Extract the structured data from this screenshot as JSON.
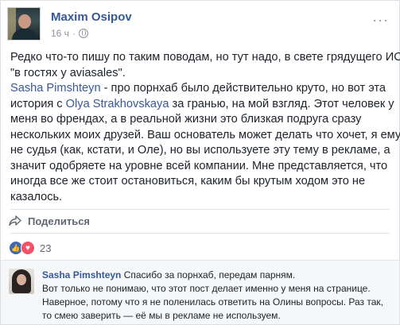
{
  "post": {
    "author": "Maxim Osipov",
    "time": "16 ч",
    "separator": "·",
    "more": "···",
    "text": {
      "p1": [
        "Редко что-то пишу по таким поводам, но тут надо, в свете грядущего ИС",
        "\"в гостях у aviasales\"."
      ],
      "mention1": "Sasha Pimshteyn",
      "p2_first_rest": " - про порнхаб было действительно круто, но вот эта",
      "p2_second_start": "история с ",
      "mention2": "Olya Strakhovskaya",
      "p2_second_rest": " за гранью, на мой взгляд. Этот человек у",
      "p2_lines": [
        "меня во френдах, а в реальной жизни это близкая подруга сразу",
        "нескольких моих друзей. Ваш основатель может делать что хочет, я ему",
        "не судья (как, кстати, и Оле), но вы используете эту тему в рекламе, а",
        "значит одобряете на уровне всей компании. Мне представляется, что",
        "иногда все же стоит остановиться, каким бы крутым ходом это не",
        "казалось."
      ]
    },
    "share_label": "Поделиться",
    "reactions_count": "23"
  },
  "comment": {
    "author": "Sasha Pimshteyn",
    "first_line_rest": " Спасибо за порнхаб, передам парням.",
    "lines": [
      "Вот только не понимаю, что этот пост делает именно у меня на странице.",
      "Наверное, потому что я не поленилась ответить на Олины вопросы. Раз так,",
      "то смею заверить — её мы в рекламе не используем."
    ]
  },
  "colors": {
    "link": "#365899",
    "like": "#4267b2",
    "love": "#f25268",
    "muted": "#90949c"
  }
}
